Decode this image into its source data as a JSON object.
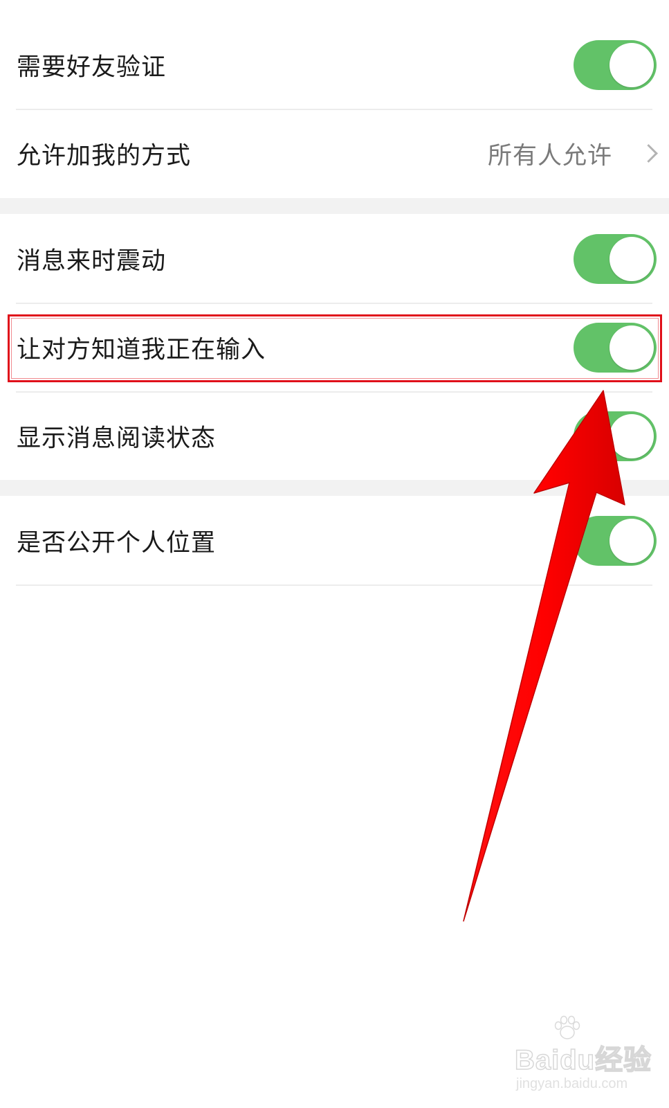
{
  "settings": {
    "group1": {
      "require_verification": {
        "label": "需要好友验证",
        "enabled": true
      },
      "add_method": {
        "label": "允许加我的方式",
        "value": "所有人允许"
      }
    },
    "group2": {
      "vibrate": {
        "label": "消息来时震动",
        "enabled": true
      },
      "typing_indicator": {
        "label": "让对方知道我正在输入",
        "enabled": true
      },
      "read_status": {
        "label": "显示消息阅读状态",
        "enabled": true
      }
    },
    "group3": {
      "public_location": {
        "label": "是否公开个人位置",
        "enabled": true
      }
    }
  },
  "annotation": {
    "highlight_color": "#e0101a",
    "arrow_color": "#ff0000",
    "highlighted_item": "typing_indicator"
  },
  "colors": {
    "toggle_on": "#62c268",
    "separator_band": "#f2f2f2",
    "secondary_text": "#7a7a7a"
  },
  "watermark": {
    "text": "Baidu经验",
    "url": "jingyan.baidu.com"
  }
}
